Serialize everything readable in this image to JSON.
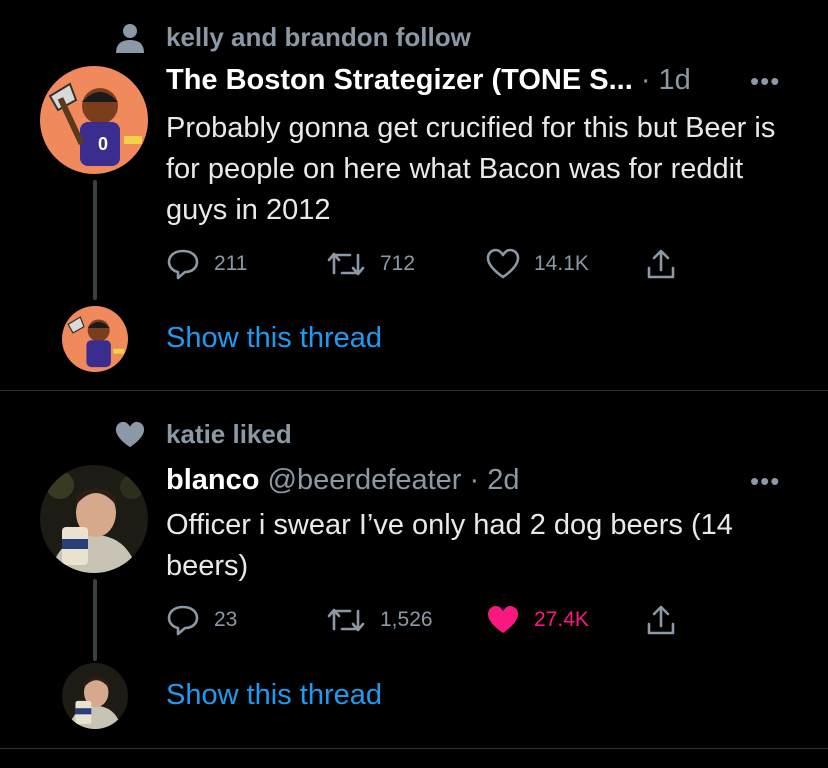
{
  "tweets": [
    {
      "context_text": "kelly and brandon follow",
      "context_icon": "person-icon",
      "name": "The Boston Strategizer (TONE S...",
      "handle": "",
      "separator": "·",
      "time": "1d",
      "text": "Probably gonna get crucified for this but Beer is for people on here what Bacon was for reddit guys in 2012",
      "replies": "211",
      "retweets": "712",
      "likes": "14.1K",
      "liked": false,
      "show_thread": "Show this thread"
    },
    {
      "context_text": "katie liked",
      "context_icon": "heart-icon",
      "name": "blanco",
      "handle": "@beerdefeater",
      "separator": "·",
      "time": "2d",
      "text": "Officer i swear I’ve only had 2 dog beers (14 beers)",
      "replies": "23",
      "retweets": "1,526",
      "likes": "27.4K",
      "liked": true,
      "show_thread": "Show this thread"
    }
  ],
  "colors": {
    "background": "#000000",
    "link": "#1d9bf0",
    "muted": "#8b98a5",
    "like": "#f91880"
  }
}
